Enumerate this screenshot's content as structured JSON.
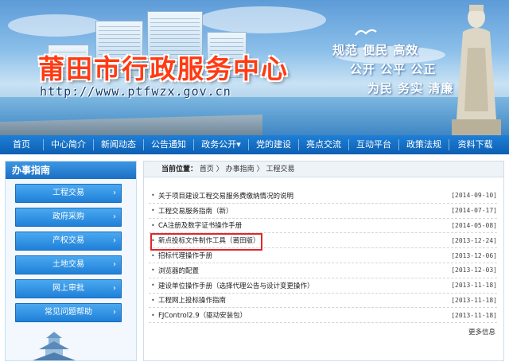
{
  "banner": {
    "title": "莆田市行政服务中心",
    "url": "http://www.ptfwzx.gov.cn",
    "slogan_line1": "规范 便民 高效",
    "slogan_line2": "公开 公平 公正",
    "slogan_line3": "为民 务实 清廉"
  },
  "nav": {
    "items": [
      {
        "label": "首页"
      },
      {
        "label": "中心简介"
      },
      {
        "label": "新闻动态"
      },
      {
        "label": "公告通知"
      },
      {
        "label": "政务公开▾"
      },
      {
        "label": "党的建设"
      },
      {
        "label": "亮点交流"
      },
      {
        "label": "互动平台"
      },
      {
        "label": "政策法规"
      },
      {
        "label": "资料下载"
      }
    ]
  },
  "sidebar": {
    "heading": "办事指南",
    "items": [
      {
        "label": "工程交易"
      },
      {
        "label": "政府采购"
      },
      {
        "label": "产权交易"
      },
      {
        "label": "土地交易"
      },
      {
        "label": "网上审批"
      },
      {
        "label": "常见问题帮助"
      }
    ],
    "arrow": "›"
  },
  "breadcrumb": {
    "label": "当前位置：",
    "home": "首页",
    "sep": " 〉",
    "level1": "办事指南",
    "level2": "工程交易"
  },
  "articles": [
    {
      "title": "关于项目建设工程交易服务费缴纳情况的说明",
      "date": "[2014-09-10]"
    },
    {
      "title": "工程交易服务指南（新）",
      "date": "[2014-07-17]"
    },
    {
      "title": "CA注册及数字证书操作手册",
      "date": "[2014-05-08]"
    },
    {
      "title": "新点投标文件制作工具（莆田版）",
      "date": "[2013-12-24]"
    },
    {
      "title": "招标代理操作手册",
      "date": "[2013-12-06]"
    },
    {
      "title": "浏览器的配置",
      "date": "[2013-12-03]"
    },
    {
      "title": "建设单位操作手册（选择代理公告与设计变更操作）",
      "date": "[2013-11-18]"
    },
    {
      "title": "工程网上投标操作指南",
      "date": "[2013-11-18]"
    },
    {
      "title": "FJControl2.9（驱动安装包）",
      "date": "[2013-11-18]"
    }
  ],
  "more_link": "更多信息",
  "colors": {
    "nav_bg": "#0d5fb3",
    "title_red": "#ff3b14",
    "highlight_red": "#e0262b",
    "sidebar_button": "#1f80d8"
  }
}
